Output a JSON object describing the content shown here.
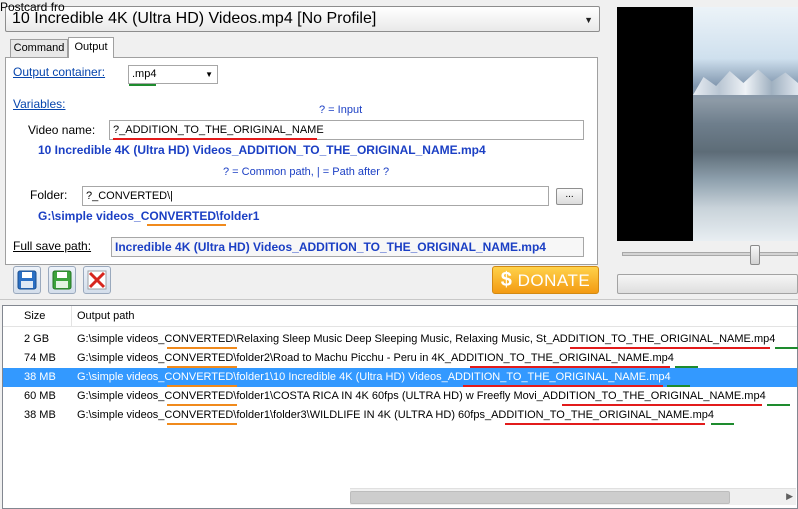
{
  "header": {
    "profile_select": "10 Incredible 4K (Ultra HD) Videos.mp4 [No Profile]"
  },
  "tabs": [
    {
      "label": "Command"
    },
    {
      "label": "Output"
    }
  ],
  "output": {
    "container_label": "Output container:",
    "container_value": ".mp4",
    "variables_label": "Variables:",
    "hint_input": "? = Input",
    "video_name_label": "Video name:",
    "video_name_value": "?_ADDITION_TO_THE_ORIGINAL_NAME",
    "video_name_preview": "10 Incredible 4K (Ultra HD) Videos_ADDITION_TO_THE_ORIGINAL_NAME.mp4",
    "hint_paths": "? = Common path, | = Path after ?",
    "folder_label": "Folder:",
    "folder_value": "?_CONVERTED\\|",
    "browse_label": "...",
    "folder_preview": "G:\\simple videos_CONVERTED\\folder1",
    "full_save_label": "Full save path:",
    "full_save_value": "Incredible 4K (Ultra HD) Videos_ADDITION_TO_THE_ORIGINAL_NAME.mp4"
  },
  "toolbar": {
    "donate_dollar": "$",
    "donate_label": "DONATE"
  },
  "preview": {
    "watermark": "Postcard fro"
  },
  "table": {
    "columns": [
      "Size",
      "Output path"
    ],
    "rows": [
      {
        "size": "2 GB",
        "path": "G:\\simple videos_CONVERTED\\Relaxing Sleep Music Deep Sleeping Music, Relaxing Music, St_ADDITION_TO_THE_ORIGINAL_NAME.mp4",
        "selected": false
      },
      {
        "size": "74 MB",
        "path": "G:\\simple videos_CONVERTED\\folder2\\Road to Machu Picchu - Peru in 4K_ADDITION_TO_THE_ORIGINAL_NAME.mp4",
        "selected": false
      },
      {
        "size": "38 MB",
        "path": "G:\\simple videos_CONVERTED\\folder1\\10 Incredible 4K (Ultra HD) Videos_ADDITION_TO_THE_ORIGINAL_NAME.mp4",
        "selected": true
      },
      {
        "size": "60 MB",
        "path": "G:\\simple videos_CONVERTED\\folder1\\COSTA RICA IN 4K 60fps (ULTRA HD) w Freefly Movi_ADDITION_TO_THE_ORIGINAL_NAME.mp4",
        "selected": false
      },
      {
        "size": "38 MB",
        "path": "G:\\simple videos_CONVERTED\\folder1\\folder3\\WILDLIFE IN 4K (ULTRA HD) 60fps_ADDITION_TO_THE_ORIGINAL_NAME.mp4",
        "selected": false
      }
    ]
  },
  "colors": {
    "selection": "#3399ff",
    "link": "#0645ad",
    "preview_blue": "#1b3fc4",
    "underline_red": "#e21b1b",
    "underline_orange": "#f08a1c",
    "underline_green": "#1e8b2e",
    "donate": "#f39a12"
  },
  "icons": [
    "save-icon",
    "save-green-icon",
    "delete-icon",
    "chevron-down-icon",
    "dollar-icon"
  ]
}
